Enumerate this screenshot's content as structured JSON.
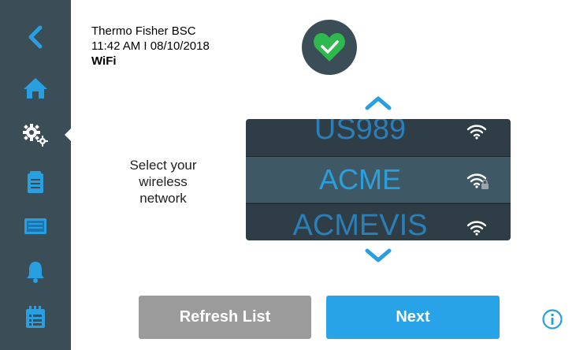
{
  "header": {
    "device": "Thermo Fisher BSC",
    "datetime": "11:42 AM I 08/10/2018",
    "screen": "WiFi"
  },
  "status": {
    "icon": "heart-check-icon",
    "color": "#2eb84e"
  },
  "prompt": {
    "lines": [
      "Select your",
      "wireless",
      "network"
    ]
  },
  "networks": [
    {
      "name": "US989",
      "icon": "wifi-icon",
      "locked": false
    },
    {
      "name": "ACME",
      "icon": "wifi-lock-icon",
      "locked": true,
      "selected": true
    },
    {
      "name": "ACMEVIS",
      "icon": "wifi-icon",
      "locked": false
    }
  ],
  "buttons": {
    "refresh": "Refresh List",
    "next": "Next"
  },
  "sidebar": {
    "items": [
      "back-icon",
      "home-icon",
      "settings-icon",
      "clipboard-icon",
      "screen-icon",
      "bell-icon",
      "calendar-list-icon"
    ],
    "selected": "settings-icon"
  },
  "colors": {
    "sidebar": "#3b4d57",
    "accent": "#2a9fe0",
    "next_button": "#29a3e8",
    "refresh_button": "#9b9b9b"
  }
}
